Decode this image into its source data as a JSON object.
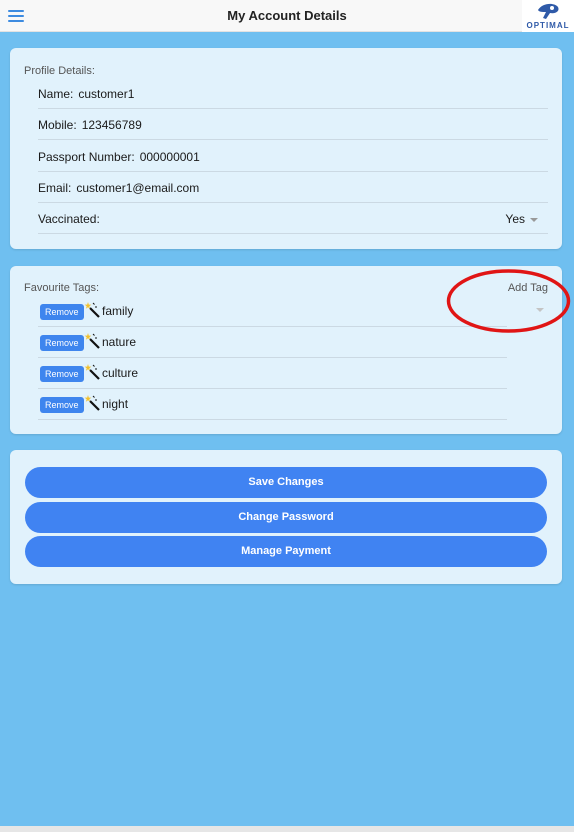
{
  "header": {
    "title": "My Account Details",
    "logo_text": "OPTIMAL",
    "menu_icon": "hamburger-menu-icon"
  },
  "profile": {
    "section_label": "Profile Details:",
    "fields": [
      {
        "label": "Name:",
        "value": "customer1"
      },
      {
        "label": "Mobile:",
        "value": "123456789"
      },
      {
        "label": "Passport Number:",
        "value": "000000001"
      },
      {
        "label": "Email:",
        "value": "customer1@email.com"
      }
    ],
    "vaccinated": {
      "label": "Vaccinated:",
      "value": "Yes"
    }
  },
  "tags": {
    "section_label": "Favourite Tags:",
    "add_label": "Add Tag",
    "remove_label": "Remove",
    "tag_icon": "magic-wand-icon",
    "items": [
      "family",
      "nature",
      "culture",
      "night"
    ]
  },
  "actions": {
    "save": "Save Changes",
    "change_password": "Change Password",
    "manage_payment": "Manage Payment"
  },
  "colors": {
    "background": "#6fbff0",
    "card": "#e1f2fc",
    "button": "#4083f2",
    "annotation": "#e01515"
  }
}
